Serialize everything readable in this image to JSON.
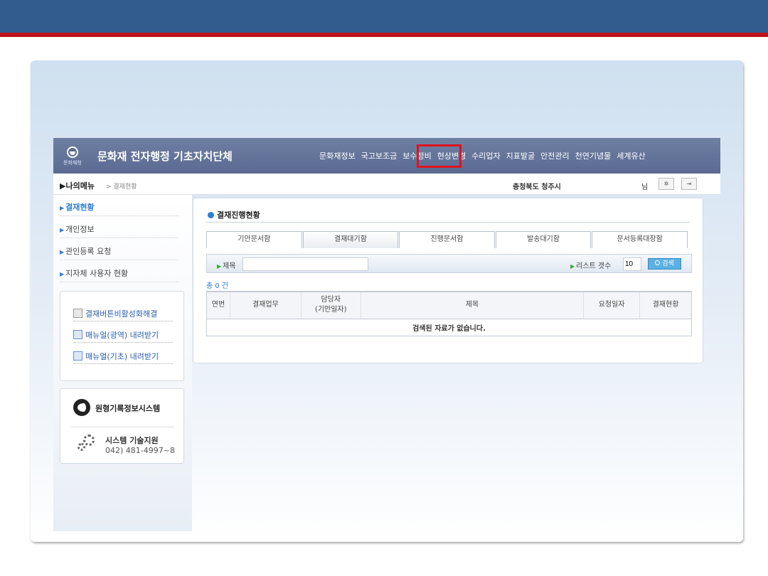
{
  "app": {
    "logo_text": "문화재청",
    "title": "문화재 전자행정 기초자치단체",
    "top_nav": [
      "문화재정보",
      "국고보조금",
      "보수정비",
      "현상변경",
      "수리업자",
      "지표발굴",
      "안전관리",
      "천연기념물",
      "세계유산"
    ]
  },
  "subbar": {
    "my_menu": "▶나의메뉴",
    "crumb": "> 결재현황",
    "region": "충청북도 청주시",
    "honorific": "님"
  },
  "sidebar": {
    "items": [
      {
        "label": "결재현황"
      },
      {
        "label": "개인정보"
      },
      {
        "label": "관인등록 요청"
      },
      {
        "label": "지자체 사용자 현황"
      }
    ],
    "links": [
      "결재버튼비활성화해결",
      "매뉴얼(광역) 내려받기",
      "매뉴얼(기초) 내려받기"
    ],
    "brand": "원형기록정보시스템",
    "support_title": "시스템 기술지원",
    "support_phone": "042) 481-4997~8"
  },
  "main": {
    "title": "결재진행현황",
    "tabs": [
      "기안문서함",
      "결재대기함",
      "진행문서함",
      "발송대기함",
      "문서등록대장함"
    ],
    "search_label": "제목",
    "search_value": "",
    "count_label": "리스트 갯수",
    "count_value": "10",
    "search_button": "검색",
    "total": "총 0 건",
    "columns": [
      "연번",
      "결재업무",
      "담당자\n(기안일자)",
      "제목",
      "요청일자",
      "결재현황"
    ],
    "empty_message": "검색된 자료가 없습니다."
  },
  "colors": {
    "topbar": "#325c8e",
    "accent_red": "#c3121b",
    "header": "#5a6a91",
    "link_blue": "#2f7fd2"
  }
}
